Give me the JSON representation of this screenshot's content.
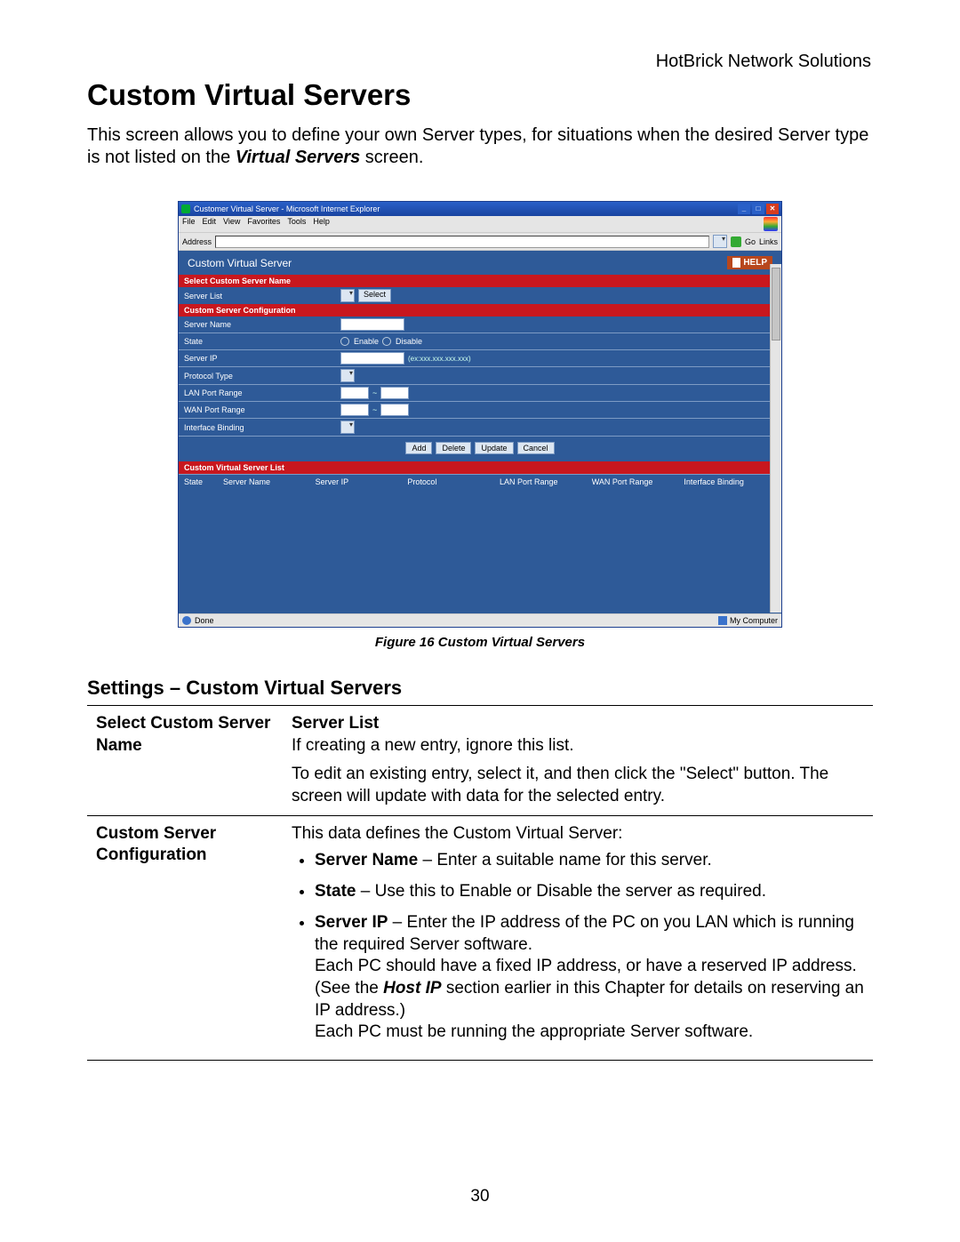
{
  "doc": {
    "brand": "HotBrick Network Solutions",
    "title": "Custom Virtual Servers",
    "intro_pre": "This screen allows you to define your own Server types, for situations when the desired Server type is not listed on the ",
    "intro_em": "Virtual Servers",
    "intro_post": " screen.",
    "figure_caption": "Figure 16 Custom Virtual Servers",
    "subhead": "Settings – Custom Virtual Servers",
    "page_number": "30"
  },
  "ie": {
    "title": "Customer Virtual Server - Microsoft Internet Explorer",
    "menu": [
      "File",
      "Edit",
      "View",
      "Favorites",
      "Tools",
      "Help"
    ],
    "address_label": "Address",
    "go_label": "Go",
    "links_label": "Links",
    "status_done": "Done",
    "status_zone": "My Computer"
  },
  "app": {
    "page_title": "Custom Virtual Server",
    "help": "HELP",
    "sec1": {
      "header": "Select Custom Server Name",
      "row_label": "Server List",
      "select_btn": "Select"
    },
    "sec2": {
      "header": "Custom Server Configuration",
      "rows": {
        "server_name": "Server Name",
        "state": "State",
        "state_enable": "Enable",
        "state_disable": "Disable",
        "server_ip": "Server IP",
        "server_ip_hint": "(ex:xxx.xxx.xxx.xxx)",
        "protocol_type": "Protocol Type",
        "lan_port": "LAN Port Range",
        "wan_port": "WAN Port Range",
        "iface": "Interface Binding"
      }
    },
    "buttons": {
      "add": "Add",
      "delete": "Delete",
      "update": "Update",
      "cancel": "Cancel"
    },
    "sec3": {
      "header": "Custom Virtual Server List",
      "cols": [
        "State",
        "Server Name",
        "Server IP",
        "Protocol",
        "LAN Port Range",
        "WAN Port Range",
        "Interface Binding"
      ]
    }
  },
  "table": {
    "r1": {
      "left": "Select Custom Server Name",
      "h": "Server List",
      "p1": "If creating a new entry, ignore this list.",
      "p2": "To edit an existing entry, select it, and then click the \"Select\" button. The screen will update with data for the selected entry."
    },
    "r2": {
      "left": "Custom Server Configuration",
      "intro": "This data defines the Custom Virtual Server:",
      "b1_h": "Server Name",
      "b1_t": " – Enter a suitable name for this server.",
      "b2_h": "State",
      "b2_t": " – Use this to Enable or Disable the server as required.",
      "b3_h": "Server IP",
      "b3_t1": " – Enter the IP address of the PC on you LAN which is running the required Server software.",
      "b3_t2": "Each PC should have a fixed IP address, or have a reserved IP address. (See the ",
      "b3_em": "Host IP",
      "b3_t3": " section earlier in this Chapter for details on reserving an IP address.)",
      "b3_t4": "Each PC must be running the appropriate Server software."
    }
  }
}
